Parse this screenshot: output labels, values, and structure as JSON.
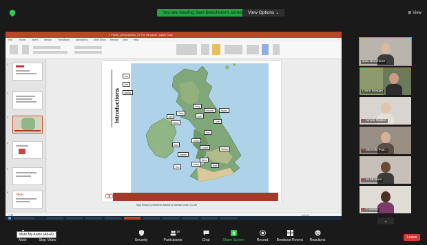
{
  "top": {
    "viewing_banner": "You are viewing Sam Beecherer's screen",
    "view_options": "View Options ⌄",
    "view_label": "⊞ View"
  },
  "powerpoint": {
    "title_text": "7 Pupils_personalities_Xt The Introduce, slides Slide",
    "tabs": [
      "File",
      "Home",
      "Insert",
      "Design",
      "Transitions",
      "Animations",
      "Slide Show",
      "Review",
      "View",
      "Help"
    ],
    "slide_heading": "Introductions",
    "names": {
      "jon": "Jon",
      "dan": "Dan",
      "ashley": "Ashley",
      "emily": "Emily",
      "michelle": "Michelle",
      "alyson": "Alyson",
      "claire": "Claire",
      "lynn": "Lynn",
      "alex": "Alex",
      "nicola": "Nicola",
      "rob": "Rob",
      "lesley": "Lesley",
      "charlie": "Charlie",
      "alan": "Alan",
      "richard": "Richard",
      "andrew": "Andrew",
      "steve": "Steve",
      "trev": "Trev",
      "jenny": "Jenny",
      "mark": "Mark"
    },
    "citation": "Map Ready by Nabeeha Nadhie is licensed under CC BY",
    "thumb_brand": "TECH"
  },
  "participants": [
    {
      "name": "Sam Beecherer",
      "muted": false,
      "active": true
    },
    {
      "name": "Claire Morgan",
      "muted": false,
      "active": false
    },
    {
      "name": "Aimee Walker",
      "muted": true,
      "active": false
    },
    {
      "name": "Michelle Pue...",
      "muted": true,
      "active": false
    },
    {
      "name": "Jo Mclaren",
      "muted": true,
      "active": false
    },
    {
      "name": "Fi Eaton",
      "muted": true,
      "active": false
    }
  ],
  "toolbar": {
    "mute": "Mute",
    "stop_video": "Stop Video",
    "security": "Security",
    "participants": "Participants",
    "participants_count": "18",
    "chat": "Chat",
    "share_screen": "Share Screen",
    "record": "Record",
    "breakout_rooms": "Breakout Rooms",
    "reactions": "Reactions",
    "leave": "Leave",
    "mute_tooltip": "Mute My Audio (Alt+A)"
  },
  "colors": {
    "zoom_green": "#2fc94e",
    "leave_red": "#d63a33",
    "ppt_red": "#b7472a"
  }
}
